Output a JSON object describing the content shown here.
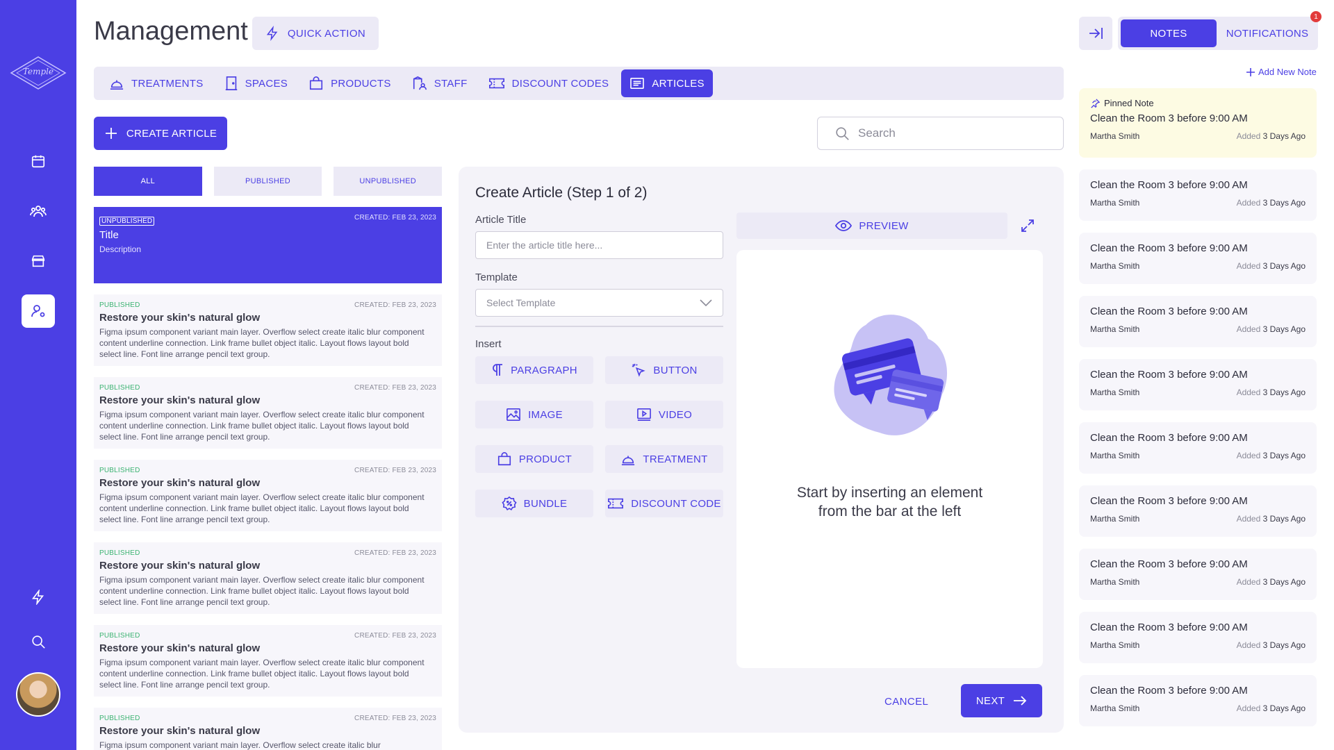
{
  "sidebar": {
    "logo_text": "Temple",
    "logo_sub": "DAY SPA"
  },
  "header": {
    "title": "Management",
    "quick_action": "QUICK ACTION"
  },
  "tabs": [
    {
      "label": "TREATMENTS",
      "icon": "bell-icon"
    },
    {
      "label": "SPACES",
      "icon": "door-icon"
    },
    {
      "label": "PRODUCTS",
      "icon": "bag-icon"
    },
    {
      "label": "STAFF",
      "icon": "staff-icon"
    },
    {
      "label": "DISCOUNT CODES",
      "icon": "ticket-icon"
    },
    {
      "label": "ARTICLES",
      "icon": "articles-icon",
      "active": true
    }
  ],
  "create_article": "CREATE ARTICLE",
  "search": {
    "placeholder": "Search"
  },
  "filters": [
    {
      "label": "ALL",
      "active": true
    },
    {
      "label": "PUBLISHED"
    },
    {
      "label": "UNPUBLISHED"
    }
  ],
  "articles": [
    {
      "status": "UNPUBLISHED",
      "created": "CREATED: FEB 23, 2023",
      "title": "Title",
      "desc": "Description",
      "selected": true
    },
    {
      "status": "PUBLISHED",
      "created": "CREATED: FEB 23, 2023",
      "title": "Restore your skin's natural glow",
      "desc": "Figma ipsum component variant main layer. Overflow select create italic blur component content underline connection. Link frame bullet object italic. Layout flows layout bold select line. Font line arrange pencil text group."
    },
    {
      "status": "PUBLISHED",
      "created": "CREATED: FEB 23, 2023",
      "title": "Restore your skin's natural glow",
      "desc": "Figma ipsum component variant main layer. Overflow select create italic blur component content underline connection. Link frame bullet object italic. Layout flows layout bold select line. Font line arrange pencil text group."
    },
    {
      "status": "PUBLISHED",
      "created": "CREATED: FEB 23, 2023",
      "title": "Restore your skin's natural glow",
      "desc": "Figma ipsum component variant main layer. Overflow select create italic blur component content underline connection. Link frame bullet object italic. Layout flows layout bold select line. Font line arrange pencil text group."
    },
    {
      "status": "PUBLISHED",
      "created": "CREATED: FEB 23, 2023",
      "title": "Restore your skin's natural glow",
      "desc": "Figma ipsum component variant main layer. Overflow select create italic blur component content underline connection. Link frame bullet object italic. Layout flows layout bold select line. Font line arrange pencil text group."
    },
    {
      "status": "PUBLISHED",
      "created": "CREATED: FEB 23, 2023",
      "title": "Restore your skin's natural glow",
      "desc": "Figma ipsum component variant main layer. Overflow select create italic blur component content underline connection. Link frame bullet object italic. Layout flows layout bold select line. Font line arrange pencil text group."
    },
    {
      "status": "PUBLISHED",
      "created": "CREATED: FEB 23, 2023",
      "title": "Restore your skin's natural glow",
      "desc": "Figma ipsum component variant main layer. Overflow select create italic blur"
    }
  ],
  "editor": {
    "title": "Create Article (Step 1 of 2)",
    "article_title_label": "Article Title",
    "article_title_placeholder": "Enter the article title here...",
    "template_label": "Template",
    "template_placeholder": "Select Template",
    "insert_label": "Insert",
    "insert_buttons": [
      {
        "label": "PARAGRAPH",
        "icon": "paragraph-icon"
      },
      {
        "label": "BUTTON",
        "icon": "pointer-icon"
      },
      {
        "label": "IMAGE",
        "icon": "image-icon"
      },
      {
        "label": "VIDEO",
        "icon": "video-icon"
      },
      {
        "label": "PRODUCT",
        "icon": "bag-icon"
      },
      {
        "label": "TREATMENT",
        "icon": "bell-icon"
      },
      {
        "label": "BUNDLE",
        "icon": "bundle-icon"
      },
      {
        "label": "DISCOUNT CODE",
        "icon": "ticket-icon"
      }
    ],
    "preview": "PREVIEW",
    "empty_line1": "Start by inserting an element",
    "empty_line2": "from the bar at the left",
    "cancel": "CANCEL",
    "next": "NEXT"
  },
  "notes_panel": {
    "notes_tab": "NOTES",
    "notifications_tab": "NOTIFICATIONS",
    "badge": "1",
    "add_note": "Add New Note",
    "pinned_label": "Pinned Note",
    "notes": [
      {
        "title": "Clean the Room 3 before 9:00 AM",
        "author": "Martha Smith",
        "added_label": "Added",
        "added": "3 Days Ago",
        "pinned": true
      },
      {
        "title": "Clean the Room 3 before 9:00 AM",
        "author": "Martha Smith",
        "added_label": "Added",
        "added": "3 Days Ago"
      },
      {
        "title": "Clean the Room 3 before 9:00 AM",
        "author": "Martha Smith",
        "added_label": "Added",
        "added": "3 Days Ago"
      },
      {
        "title": "Clean the Room 3 before 9:00 AM",
        "author": "Martha Smith",
        "added_label": "Added",
        "added": "3 Days Ago"
      },
      {
        "title": "Clean the Room 3 before 9:00 AM",
        "author": "Martha Smith",
        "added_label": "Added",
        "added": "3 Days Ago"
      },
      {
        "title": "Clean the Room 3 before 9:00 AM",
        "author": "Martha Smith",
        "added_label": "Added",
        "added": "3 Days Ago"
      },
      {
        "title": "Clean the Room 3 before 9:00 AM",
        "author": "Martha Smith",
        "added_label": "Added",
        "added": "3 Days Ago"
      },
      {
        "title": "Clean the Room 3 before 9:00 AM",
        "author": "Martha Smith",
        "added_label": "Added",
        "added": "3 Days Ago"
      },
      {
        "title": "Clean the Room 3 before 9:00 AM",
        "author": "Martha Smith",
        "added_label": "Added",
        "added": "3 Days Ago"
      },
      {
        "title": "Clean the Room 3 before 9:00 AM",
        "author": "Martha Smith",
        "added_label": "Added",
        "added": "3 Days Ago"
      }
    ]
  },
  "colors": {
    "primary": "#4b3fe4",
    "light": "#eceaf6",
    "published": "#3bb371",
    "pinned_bg": "#fdfbe3",
    "badge": "#e23b3b"
  }
}
